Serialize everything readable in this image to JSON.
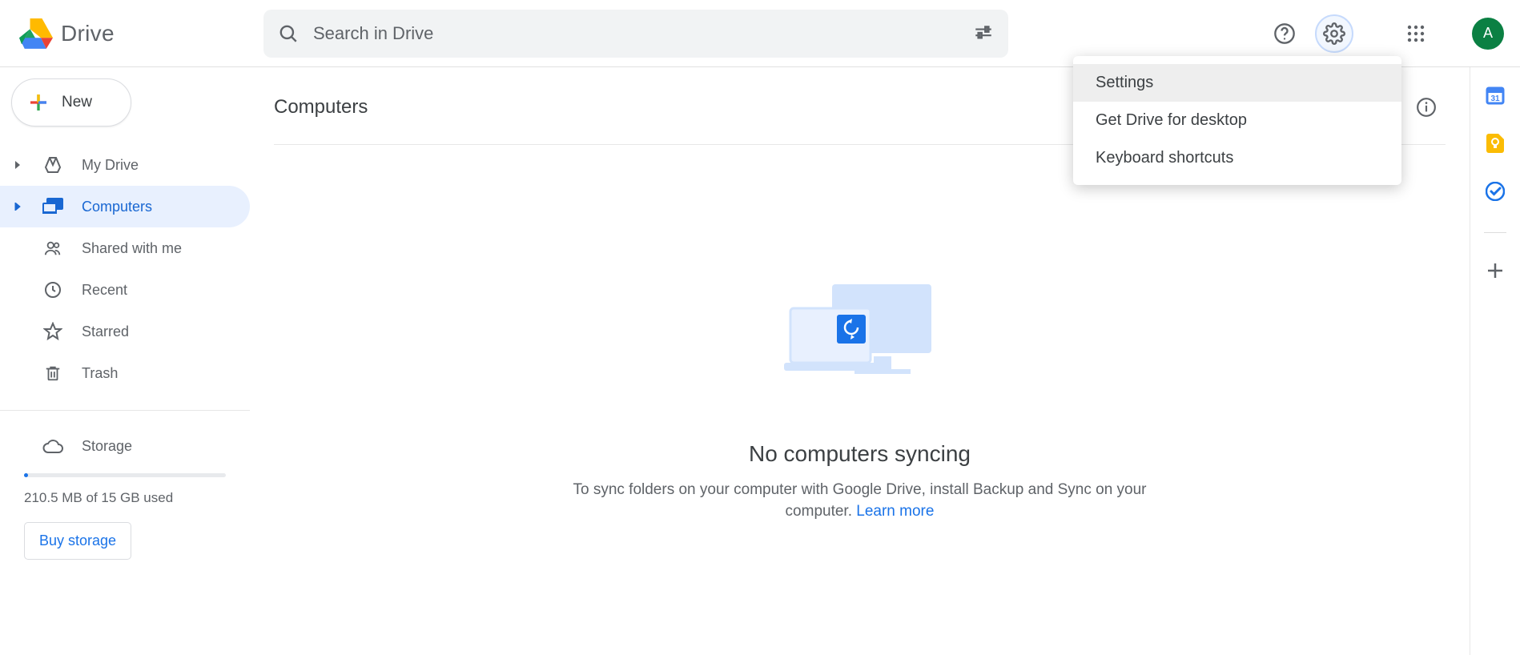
{
  "header": {
    "product": "Drive",
    "search_placeholder": "Search in Drive",
    "avatar_initial": "A"
  },
  "settings_menu": {
    "items": [
      {
        "label": "Settings"
      },
      {
        "label": "Get Drive for desktop"
      },
      {
        "label": "Keyboard shortcuts"
      }
    ]
  },
  "sidebar": {
    "new_label": "New",
    "items": [
      {
        "label": "My Drive"
      },
      {
        "label": "Computers"
      },
      {
        "label": "Shared with me"
      },
      {
        "label": "Recent"
      },
      {
        "label": "Starred"
      },
      {
        "label": "Trash"
      }
    ],
    "storage_label": "Storage",
    "storage_usage": "210.5 MB of 15 GB used",
    "buy_label": "Buy storage"
  },
  "main": {
    "title": "Computers",
    "empty_title": "No computers syncing",
    "empty_text_pre": "To sync folders on your computer with Google Drive, install Backup and Sync on your computer. ",
    "empty_link": "Learn more"
  }
}
